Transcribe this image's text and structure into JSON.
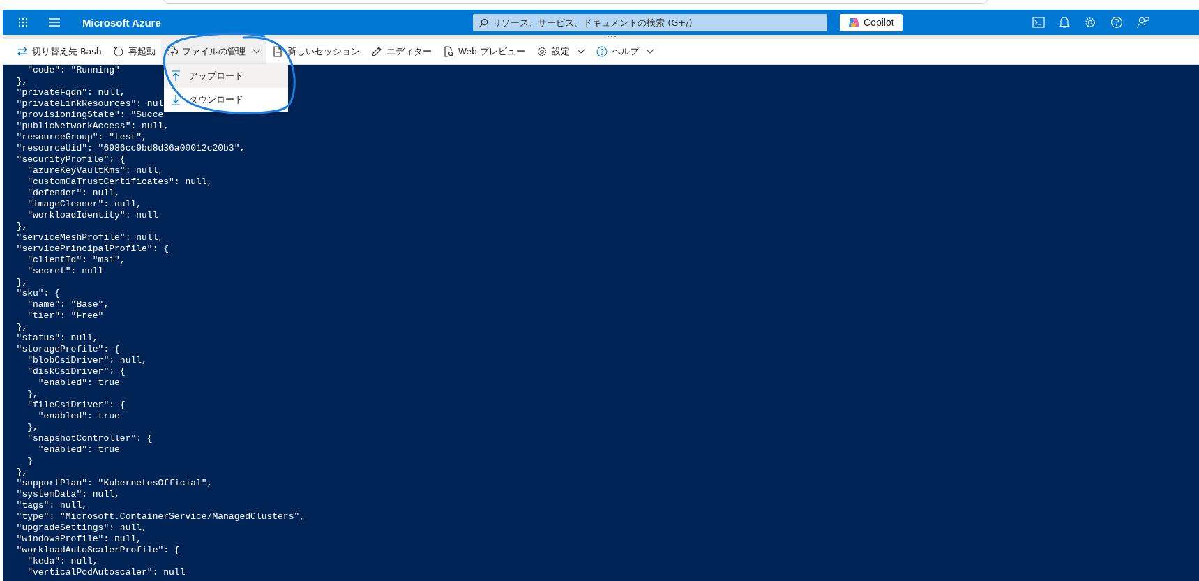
{
  "header": {
    "title": "Microsoft Azure",
    "search": {
      "placeholder": "リソース、サービス、ドキュメントの検索 (G+/)"
    },
    "copilot_button": "Copilot"
  },
  "toolbar": [
    {
      "label": "切り替え先 Bash",
      "dropdown": false,
      "expanded": false
    },
    {
      "label": "再起動",
      "dropdown": false,
      "expanded": false
    },
    {
      "label": "ファイルの管理",
      "dropdown": true,
      "expanded": true
    },
    {
      "label": "新しいセッション",
      "dropdown": false,
      "expanded": false
    },
    {
      "label": "エディター",
      "dropdown": false,
      "expanded": false
    },
    {
      "label": "Web プレビュー",
      "dropdown": false,
      "expanded": false
    },
    {
      "label": "設定",
      "dropdown": true,
      "expanded": false
    },
    {
      "label": "ヘルプ",
      "dropdown": true,
      "expanded": false
    }
  ],
  "menu": {
    "items": [
      {
        "label": "アップロード",
        "selected": true
      },
      {
        "label": "ダウンロード",
        "selected": false
      }
    ]
  },
  "terminal": {
    "lines": [
      "    \"code\": \"Running\"",
      "  },",
      "  \"privateFqdn\": null,",
      "  \"privateLinkResources\": nul",
      "  \"provisioningState\": \"Succe",
      "  \"publicNetworkAccess\": null,",
      "  \"resourceGroup\": \"test\",",
      "  \"resourceUid\": \"6986cc9bd8d36a00012c20b3\",",
      "  \"securityProfile\": {",
      "    \"azureKeyVaultKms\": null,",
      "    \"customCaTrustCertificates\": null,",
      "    \"defender\": null,",
      "    \"imageCleaner\": null,",
      "    \"workloadIdentity\": null",
      "  },",
      "  \"serviceMeshProfile\": null,",
      "  \"servicePrincipalProfile\": {",
      "    \"clientId\": \"msi\",",
      "    \"secret\": null",
      "  },",
      "  \"sku\": {",
      "    \"name\": \"Base\",",
      "    \"tier\": \"Free\"",
      "  },",
      "  \"status\": null,",
      "  \"storageProfile\": {",
      "    \"blobCsiDriver\": null,",
      "    \"diskCsiDriver\": {",
      "      \"enabled\": true",
      "    },",
      "    \"fileCsiDriver\": {",
      "      \"enabled\": true",
      "    },",
      "    \"snapshotController\": {",
      "      \"enabled\": true",
      "    }",
      "  },",
      "  \"supportPlan\": \"KubernetesOfficial\",",
      "  \"systemData\": null,",
      "  \"tags\": null,",
      "  \"type\": \"Microsoft.ContainerService/ManagedClusters\",",
      "  \"upgradeSettings\": null,",
      "  \"windowsProfile\": null,",
      "  \"workloadAutoScalerProfile\": {",
      "    \"keda\": null,",
      "    \"verticalPodAutoscaler\": null"
    ]
  }
}
